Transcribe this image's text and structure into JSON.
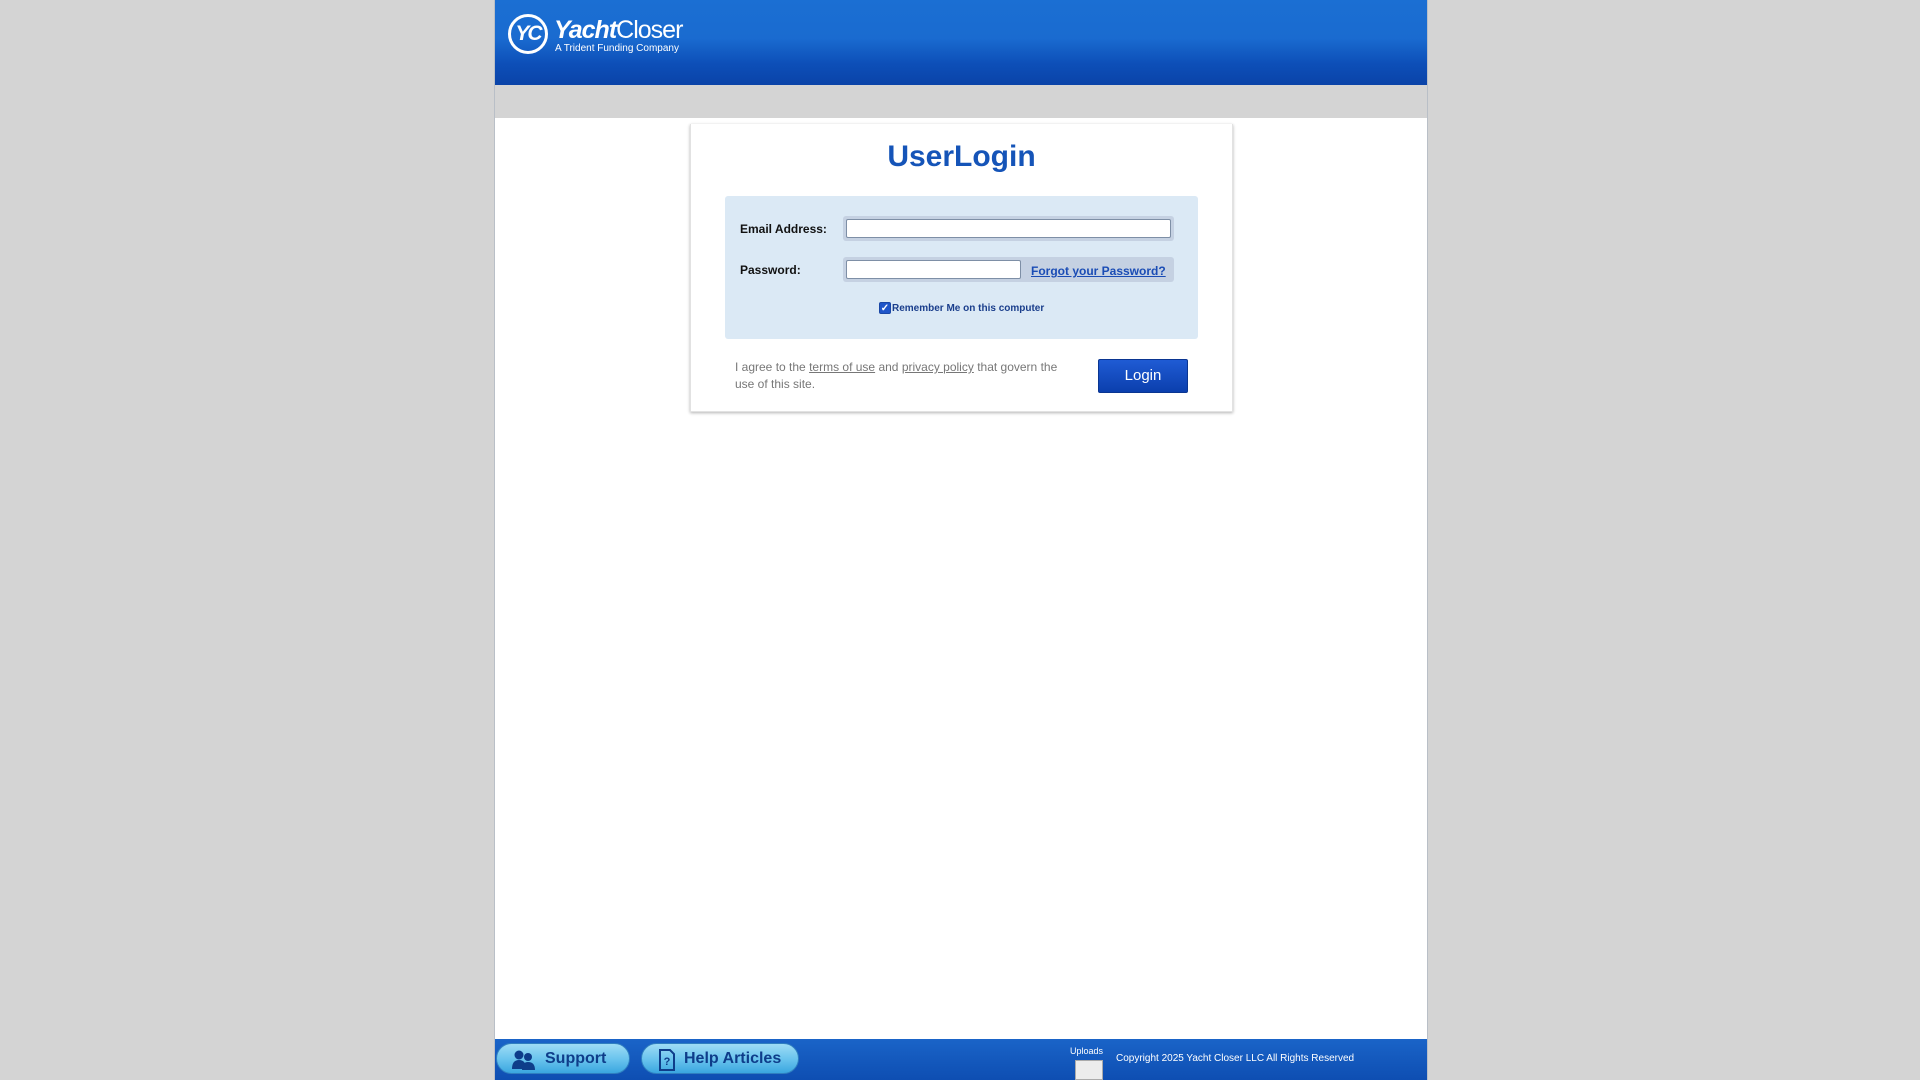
{
  "header": {
    "logo_mark": "YC",
    "logo_name_bold": "Yacht",
    "logo_name_light": "Closer",
    "logo_tagline": "A Trident Funding Company"
  },
  "login": {
    "title": "UserLogin",
    "email_label": "Email Address:",
    "email_value": "",
    "password_label": "Password:",
    "password_value": "",
    "forgot_link": "Forgot your Password?",
    "remember_label": "Remember Me on this computer",
    "remember_checked": true,
    "agree_prefix": "I agree to the",
    "terms_link": "terms of use",
    "agree_and": "and",
    "privacy_link": "privacy policy",
    "agree_suffix": "that govern the use of this site.",
    "login_button": "Login"
  },
  "footer": {
    "support_button": "Support",
    "help_button": "Help Articles",
    "uploads_label": "Uploads",
    "copyright": "Copyright 2025 Yacht Closer LLC All Rights Reserved"
  },
  "colors": {
    "header_blue": "#1a6bd0",
    "title_blue": "#1554b8",
    "panel_bg": "#dbe9f5",
    "button_blue": "#0b3fad"
  }
}
